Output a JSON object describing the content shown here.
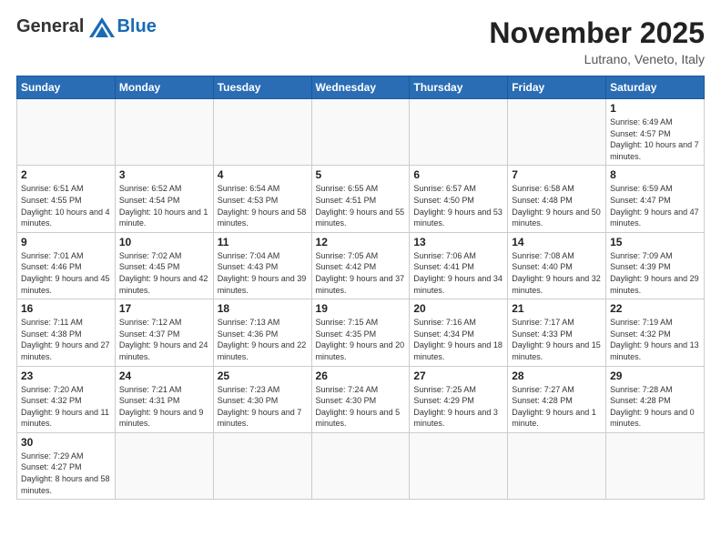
{
  "logo": {
    "general": "General",
    "blue": "Blue"
  },
  "title": "November 2025",
  "location": "Lutrano, Veneto, Italy",
  "weekdays": [
    "Sunday",
    "Monday",
    "Tuesday",
    "Wednesday",
    "Thursday",
    "Friday",
    "Saturday"
  ],
  "weeks": [
    [
      {
        "day": "",
        "info": ""
      },
      {
        "day": "",
        "info": ""
      },
      {
        "day": "",
        "info": ""
      },
      {
        "day": "",
        "info": ""
      },
      {
        "day": "",
        "info": ""
      },
      {
        "day": "",
        "info": ""
      },
      {
        "day": "1",
        "info": "Sunrise: 6:49 AM\nSunset: 4:57 PM\nDaylight: 10 hours and 7 minutes."
      }
    ],
    [
      {
        "day": "2",
        "info": "Sunrise: 6:51 AM\nSunset: 4:55 PM\nDaylight: 10 hours and 4 minutes."
      },
      {
        "day": "3",
        "info": "Sunrise: 6:52 AM\nSunset: 4:54 PM\nDaylight: 10 hours and 1 minute."
      },
      {
        "day": "4",
        "info": "Sunrise: 6:54 AM\nSunset: 4:53 PM\nDaylight: 9 hours and 58 minutes."
      },
      {
        "day": "5",
        "info": "Sunrise: 6:55 AM\nSunset: 4:51 PM\nDaylight: 9 hours and 55 minutes."
      },
      {
        "day": "6",
        "info": "Sunrise: 6:57 AM\nSunset: 4:50 PM\nDaylight: 9 hours and 53 minutes."
      },
      {
        "day": "7",
        "info": "Sunrise: 6:58 AM\nSunset: 4:48 PM\nDaylight: 9 hours and 50 minutes."
      },
      {
        "day": "8",
        "info": "Sunrise: 6:59 AM\nSunset: 4:47 PM\nDaylight: 9 hours and 47 minutes."
      }
    ],
    [
      {
        "day": "9",
        "info": "Sunrise: 7:01 AM\nSunset: 4:46 PM\nDaylight: 9 hours and 45 minutes."
      },
      {
        "day": "10",
        "info": "Sunrise: 7:02 AM\nSunset: 4:45 PM\nDaylight: 9 hours and 42 minutes."
      },
      {
        "day": "11",
        "info": "Sunrise: 7:04 AM\nSunset: 4:43 PM\nDaylight: 9 hours and 39 minutes."
      },
      {
        "day": "12",
        "info": "Sunrise: 7:05 AM\nSunset: 4:42 PM\nDaylight: 9 hours and 37 minutes."
      },
      {
        "day": "13",
        "info": "Sunrise: 7:06 AM\nSunset: 4:41 PM\nDaylight: 9 hours and 34 minutes."
      },
      {
        "day": "14",
        "info": "Sunrise: 7:08 AM\nSunset: 4:40 PM\nDaylight: 9 hours and 32 minutes."
      },
      {
        "day": "15",
        "info": "Sunrise: 7:09 AM\nSunset: 4:39 PM\nDaylight: 9 hours and 29 minutes."
      }
    ],
    [
      {
        "day": "16",
        "info": "Sunrise: 7:11 AM\nSunset: 4:38 PM\nDaylight: 9 hours and 27 minutes."
      },
      {
        "day": "17",
        "info": "Sunrise: 7:12 AM\nSunset: 4:37 PM\nDaylight: 9 hours and 24 minutes."
      },
      {
        "day": "18",
        "info": "Sunrise: 7:13 AM\nSunset: 4:36 PM\nDaylight: 9 hours and 22 minutes."
      },
      {
        "day": "19",
        "info": "Sunrise: 7:15 AM\nSunset: 4:35 PM\nDaylight: 9 hours and 20 minutes."
      },
      {
        "day": "20",
        "info": "Sunrise: 7:16 AM\nSunset: 4:34 PM\nDaylight: 9 hours and 18 minutes."
      },
      {
        "day": "21",
        "info": "Sunrise: 7:17 AM\nSunset: 4:33 PM\nDaylight: 9 hours and 15 minutes."
      },
      {
        "day": "22",
        "info": "Sunrise: 7:19 AM\nSunset: 4:32 PM\nDaylight: 9 hours and 13 minutes."
      }
    ],
    [
      {
        "day": "23",
        "info": "Sunrise: 7:20 AM\nSunset: 4:32 PM\nDaylight: 9 hours and 11 minutes."
      },
      {
        "day": "24",
        "info": "Sunrise: 7:21 AM\nSunset: 4:31 PM\nDaylight: 9 hours and 9 minutes."
      },
      {
        "day": "25",
        "info": "Sunrise: 7:23 AM\nSunset: 4:30 PM\nDaylight: 9 hours and 7 minutes."
      },
      {
        "day": "26",
        "info": "Sunrise: 7:24 AM\nSunset: 4:30 PM\nDaylight: 9 hours and 5 minutes."
      },
      {
        "day": "27",
        "info": "Sunrise: 7:25 AM\nSunset: 4:29 PM\nDaylight: 9 hours and 3 minutes."
      },
      {
        "day": "28",
        "info": "Sunrise: 7:27 AM\nSunset: 4:28 PM\nDaylight: 9 hours and 1 minute."
      },
      {
        "day": "29",
        "info": "Sunrise: 7:28 AM\nSunset: 4:28 PM\nDaylight: 9 hours and 0 minutes."
      }
    ],
    [
      {
        "day": "30",
        "info": "Sunrise: 7:29 AM\nSunset: 4:27 PM\nDaylight: 8 hours and 58 minutes."
      },
      {
        "day": "",
        "info": ""
      },
      {
        "day": "",
        "info": ""
      },
      {
        "day": "",
        "info": ""
      },
      {
        "day": "",
        "info": ""
      },
      {
        "day": "",
        "info": ""
      },
      {
        "day": "",
        "info": ""
      }
    ]
  ]
}
